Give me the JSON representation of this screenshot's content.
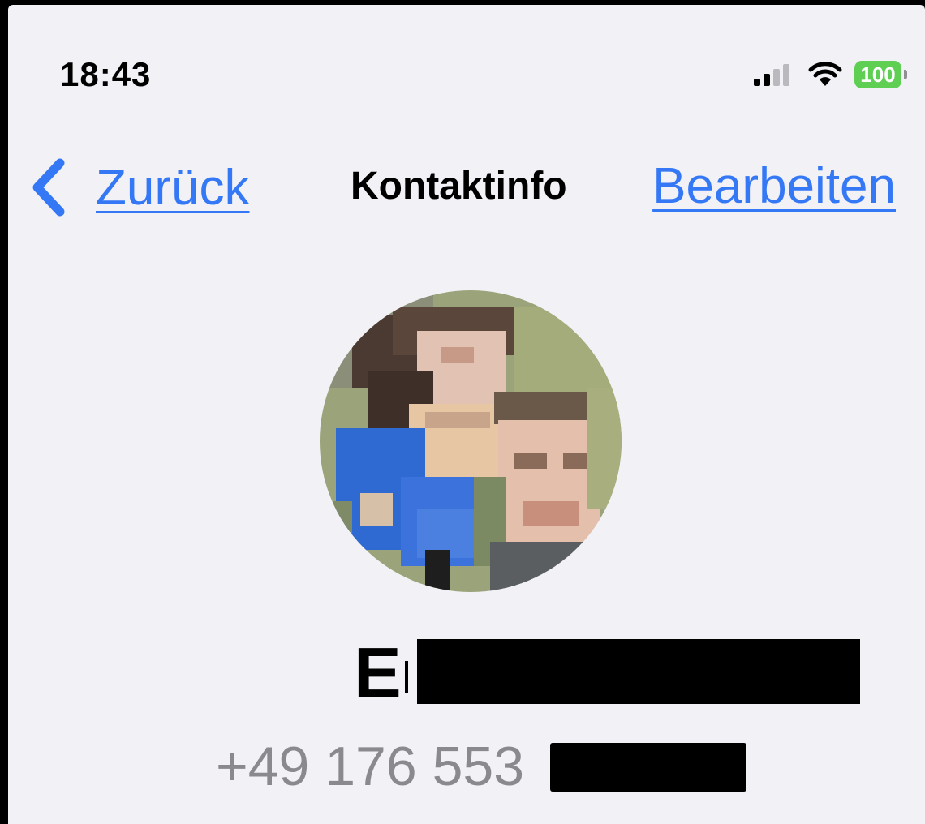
{
  "status_bar": {
    "time": "18:43",
    "battery": "100",
    "icons": [
      "cellular-signal-icon",
      "wifi-icon",
      "battery-icon"
    ]
  },
  "nav": {
    "back_label": "Zurück",
    "title": "Kontaktinfo",
    "edit_label": "Bearbeiten"
  },
  "contact": {
    "name_initial": "E",
    "phone_visible": "+49 176 553"
  },
  "colors": {
    "accent": "#3478f6",
    "background": "#f1f1f6",
    "battery": "#5fcf54",
    "secondary_text": "#8a8a8e"
  }
}
